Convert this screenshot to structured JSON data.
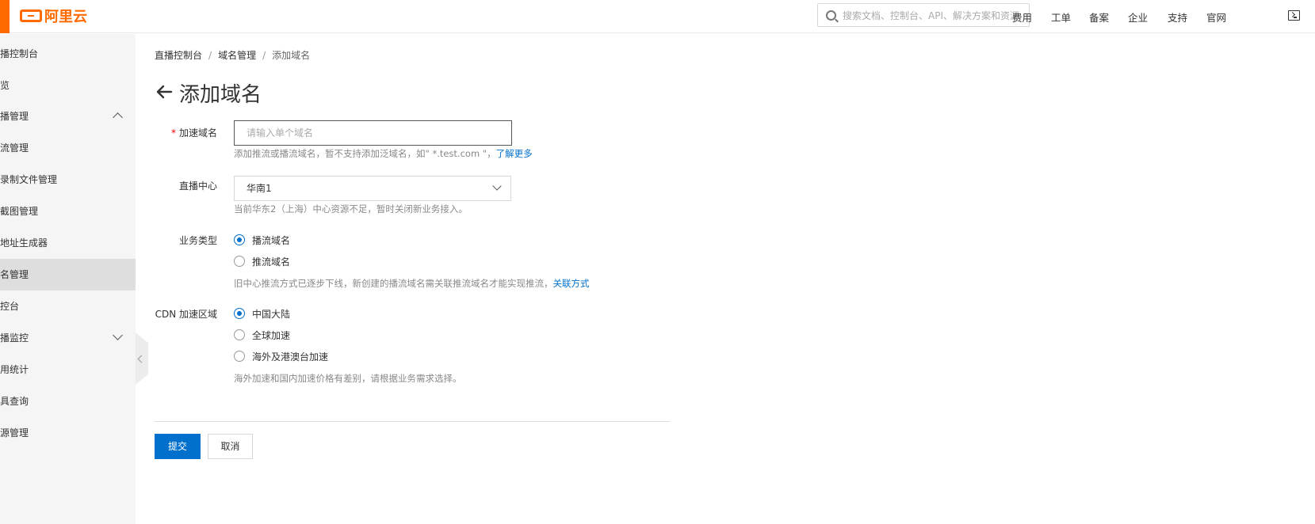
{
  "brand": {
    "logo_text": "阿里云",
    "color": "#ff6a00"
  },
  "header": {
    "search_placeholder": "搜索文档、控制台、API、解决方案和资源",
    "nav": [
      "费用",
      "工单",
      "备案",
      "企业",
      "支持",
      "官网"
    ],
    "terminal_icon": "terminal-icon"
  },
  "sidebar": {
    "items": [
      {
        "label": "播控制台"
      },
      {
        "label": "览"
      },
      {
        "label": "播管理",
        "expand": "up"
      },
      {
        "label": "流管理"
      },
      {
        "label": "录制文件管理"
      },
      {
        "label": "截图管理"
      },
      {
        "label": "地址生成器"
      },
      {
        "label": "名管理",
        "active": true
      },
      {
        "label": "控台"
      },
      {
        "label": "播监控",
        "expand": "down"
      },
      {
        "label": "用统计"
      },
      {
        "label": "具查询"
      },
      {
        "label": "源管理"
      }
    ]
  },
  "breadcrumb": {
    "items": [
      "直播控制台",
      "域名管理",
      "添加域名"
    ],
    "separator": "/"
  },
  "page": {
    "title": "添加域名"
  },
  "form": {
    "domain": {
      "label": "加速域名",
      "required_mark": "*",
      "placeholder": "请输入单个域名",
      "help": "添加推流或播流域名，暂不支持添加泛域名，如\" *.test.com \"，",
      "help_link": "了解更多"
    },
    "center": {
      "label": "直播中心",
      "value": "华南1",
      "help": "当前华东2（上海）中心资源不足，暂时关闭新业务接入。"
    },
    "biz_type": {
      "label": "业务类型",
      "options": [
        "播流域名",
        "推流域名"
      ],
      "selected": "播流域名",
      "help": "旧中心推流方式已逐步下线，新创建的播流域名需关联推流域名才能实现推流，",
      "help_link": "关联方式"
    },
    "cdn_region": {
      "label": "CDN 加速区域",
      "options": [
        "中国大陆",
        "全球加速",
        "海外及港澳台加速"
      ],
      "selected": "中国大陆",
      "help": "海外加速和国内加速价格有差别，请根据业务需求选择。"
    }
  },
  "actions": {
    "submit": "提交",
    "cancel": "取消",
    "primary_color": "#0070cc"
  }
}
